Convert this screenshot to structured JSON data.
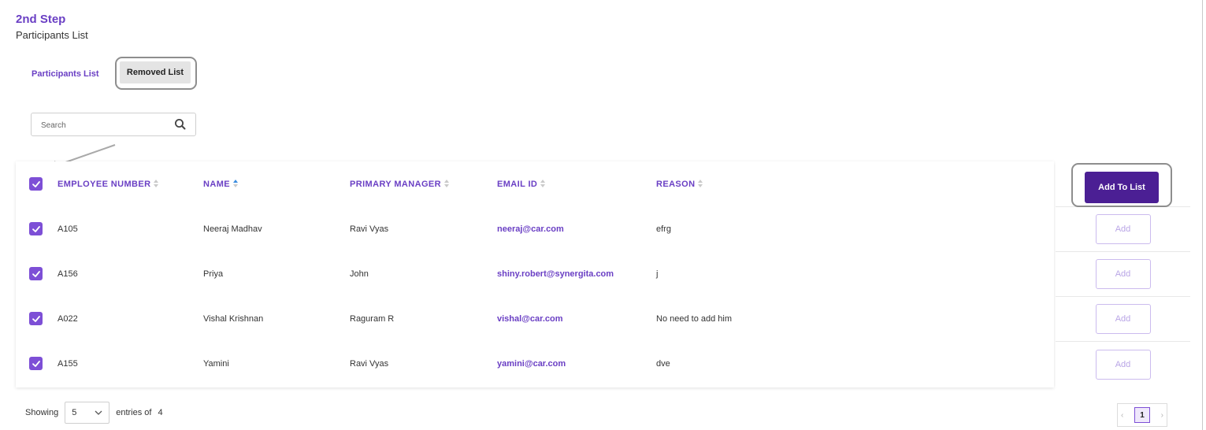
{
  "step": {
    "title": "2nd Step",
    "subtitle": "Participants List"
  },
  "tabs": [
    {
      "label": "Participants List",
      "active": true
    },
    {
      "label": "Removed List",
      "active": false
    }
  ],
  "search": {
    "placeholder": "Search",
    "value": ""
  },
  "table": {
    "columns": [
      {
        "label": "EMPLOYEE NUMBER",
        "sort": "none"
      },
      {
        "label": "NAME",
        "sort": "asc"
      },
      {
        "label": "PRIMARY MANAGER",
        "sort": "none"
      },
      {
        "label": "EMAIL ID",
        "sort": "none"
      },
      {
        "label": "REASON",
        "sort": "none"
      }
    ],
    "select_all_checked": true,
    "rows": [
      {
        "employee_number": "A105",
        "name": "Neeraj Madhav",
        "manager": "Ravi Vyas",
        "email": "neeraj@car.com",
        "reason": "efrg",
        "checked": true
      },
      {
        "employee_number": "A156",
        "name": "Priya",
        "manager": "John",
        "email": "shiny.robert@synergita.com",
        "reason": "j",
        "checked": true
      },
      {
        "employee_number": "A022",
        "name": "Vishal Krishnan",
        "manager": "Raguram R",
        "email": "vishal@car.com",
        "reason": "No need to add him",
        "checked": true
      },
      {
        "employee_number": "A155",
        "name": "Yamini",
        "manager": "Ravi Vyas",
        "email": "yamini@car.com",
        "reason": "dve",
        "checked": true
      }
    ]
  },
  "actions": {
    "add_to_list_label": "Add To List",
    "row_add_label": "Add"
  },
  "footer": {
    "showing_label": "Showing",
    "page_size": "5",
    "entries_label": "entries of",
    "total": "4"
  },
  "pagination": {
    "prev": "‹",
    "current": "1",
    "next": "›"
  },
  "colors": {
    "accent": "#6a3fc4",
    "checkbox": "#7d4fd6",
    "primary_button": "#4b1f94",
    "highlight_outline": "#8e8e8e"
  }
}
